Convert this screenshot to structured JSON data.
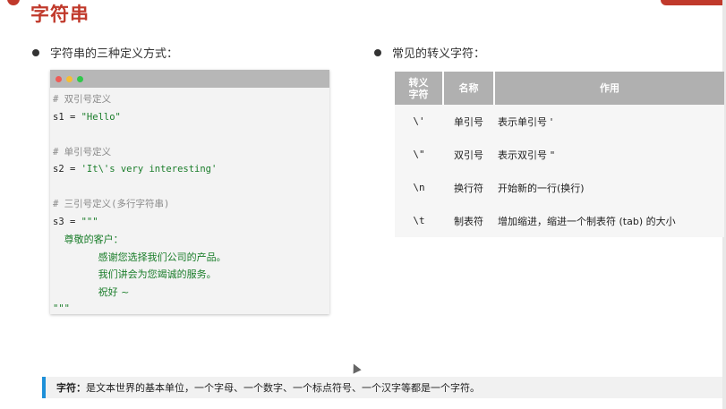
{
  "title": "字符串",
  "left": {
    "heading": "字符串的三种定义方式：",
    "code_lines": [
      {
        "type": "comment",
        "text": "# 双引号定义"
      },
      {
        "type": "code",
        "pre": "s1 = ",
        "str": "\"Hello\""
      },
      {
        "type": "blank"
      },
      {
        "type": "comment",
        "text": "# 单引号定义"
      },
      {
        "type": "code",
        "pre": "s2 = ",
        "str": "'It\\'s very interesting'"
      },
      {
        "type": "blank"
      },
      {
        "type": "comment",
        "text": "# 三引号定义(多行字符串)"
      },
      {
        "type": "code",
        "pre": "s3 = ",
        "str": "\"\"\""
      },
      {
        "type": "str",
        "indent": "  ",
        "text": "尊敬的客户："
      },
      {
        "type": "str",
        "indent": "        ",
        "text": "感谢您选择我们公司的产品。"
      },
      {
        "type": "str",
        "indent": "        ",
        "text": "我们讲会为您竭诚的服务。"
      },
      {
        "type": "str",
        "indent": "        ",
        "text": "祝好 ~"
      },
      {
        "type": "str",
        "indent": "",
        "text": "\"\"\""
      }
    ]
  },
  "right": {
    "heading": "常见的转义字符：",
    "table": {
      "headers": [
        "转义\n字符",
        "名称",
        "作用"
      ],
      "rows": [
        [
          "\\'",
          "单引号",
          "表示单引号 '"
        ],
        [
          "\\\"",
          "双引号",
          "表示双引号 \""
        ],
        [
          "\\n",
          "换行符",
          "开始新的一行(换行)"
        ],
        [
          "\\t",
          "制表符",
          "增加缩进，缩进一个制表符 (tab) 的大小"
        ]
      ]
    }
  },
  "note": {
    "label": "字符：",
    "text": "是文本世界的基本单位，一个字母、一个数字、一个标点符号、一个汉字等都是一个字符。"
  }
}
